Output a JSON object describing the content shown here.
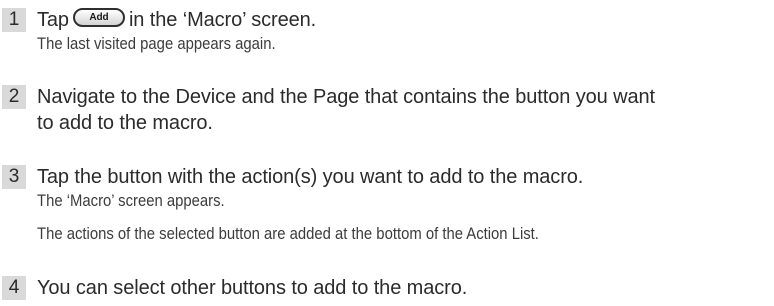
{
  "steps": [
    {
      "number": "1",
      "before_button": "Tap",
      "button_label": "Add",
      "after_button": "in the ‘Macro’ screen.",
      "notes": [
        "The last visited page appears again."
      ]
    },
    {
      "number": "2",
      "lines": [
        "Navigate to the Device and the Page that contains the button you want",
        "to add to the macro."
      ]
    },
    {
      "number": "3",
      "lines": [
        "Tap the button with the action(s) you want to add to the macro."
      ],
      "notes": [
        "The ‘Macro’ screen appears.",
        "The actions of the selected button are added at the bottom of the Action List."
      ]
    },
    {
      "number": "4",
      "lines": [
        "You can select other buttons to add to the macro."
      ]
    }
  ]
}
